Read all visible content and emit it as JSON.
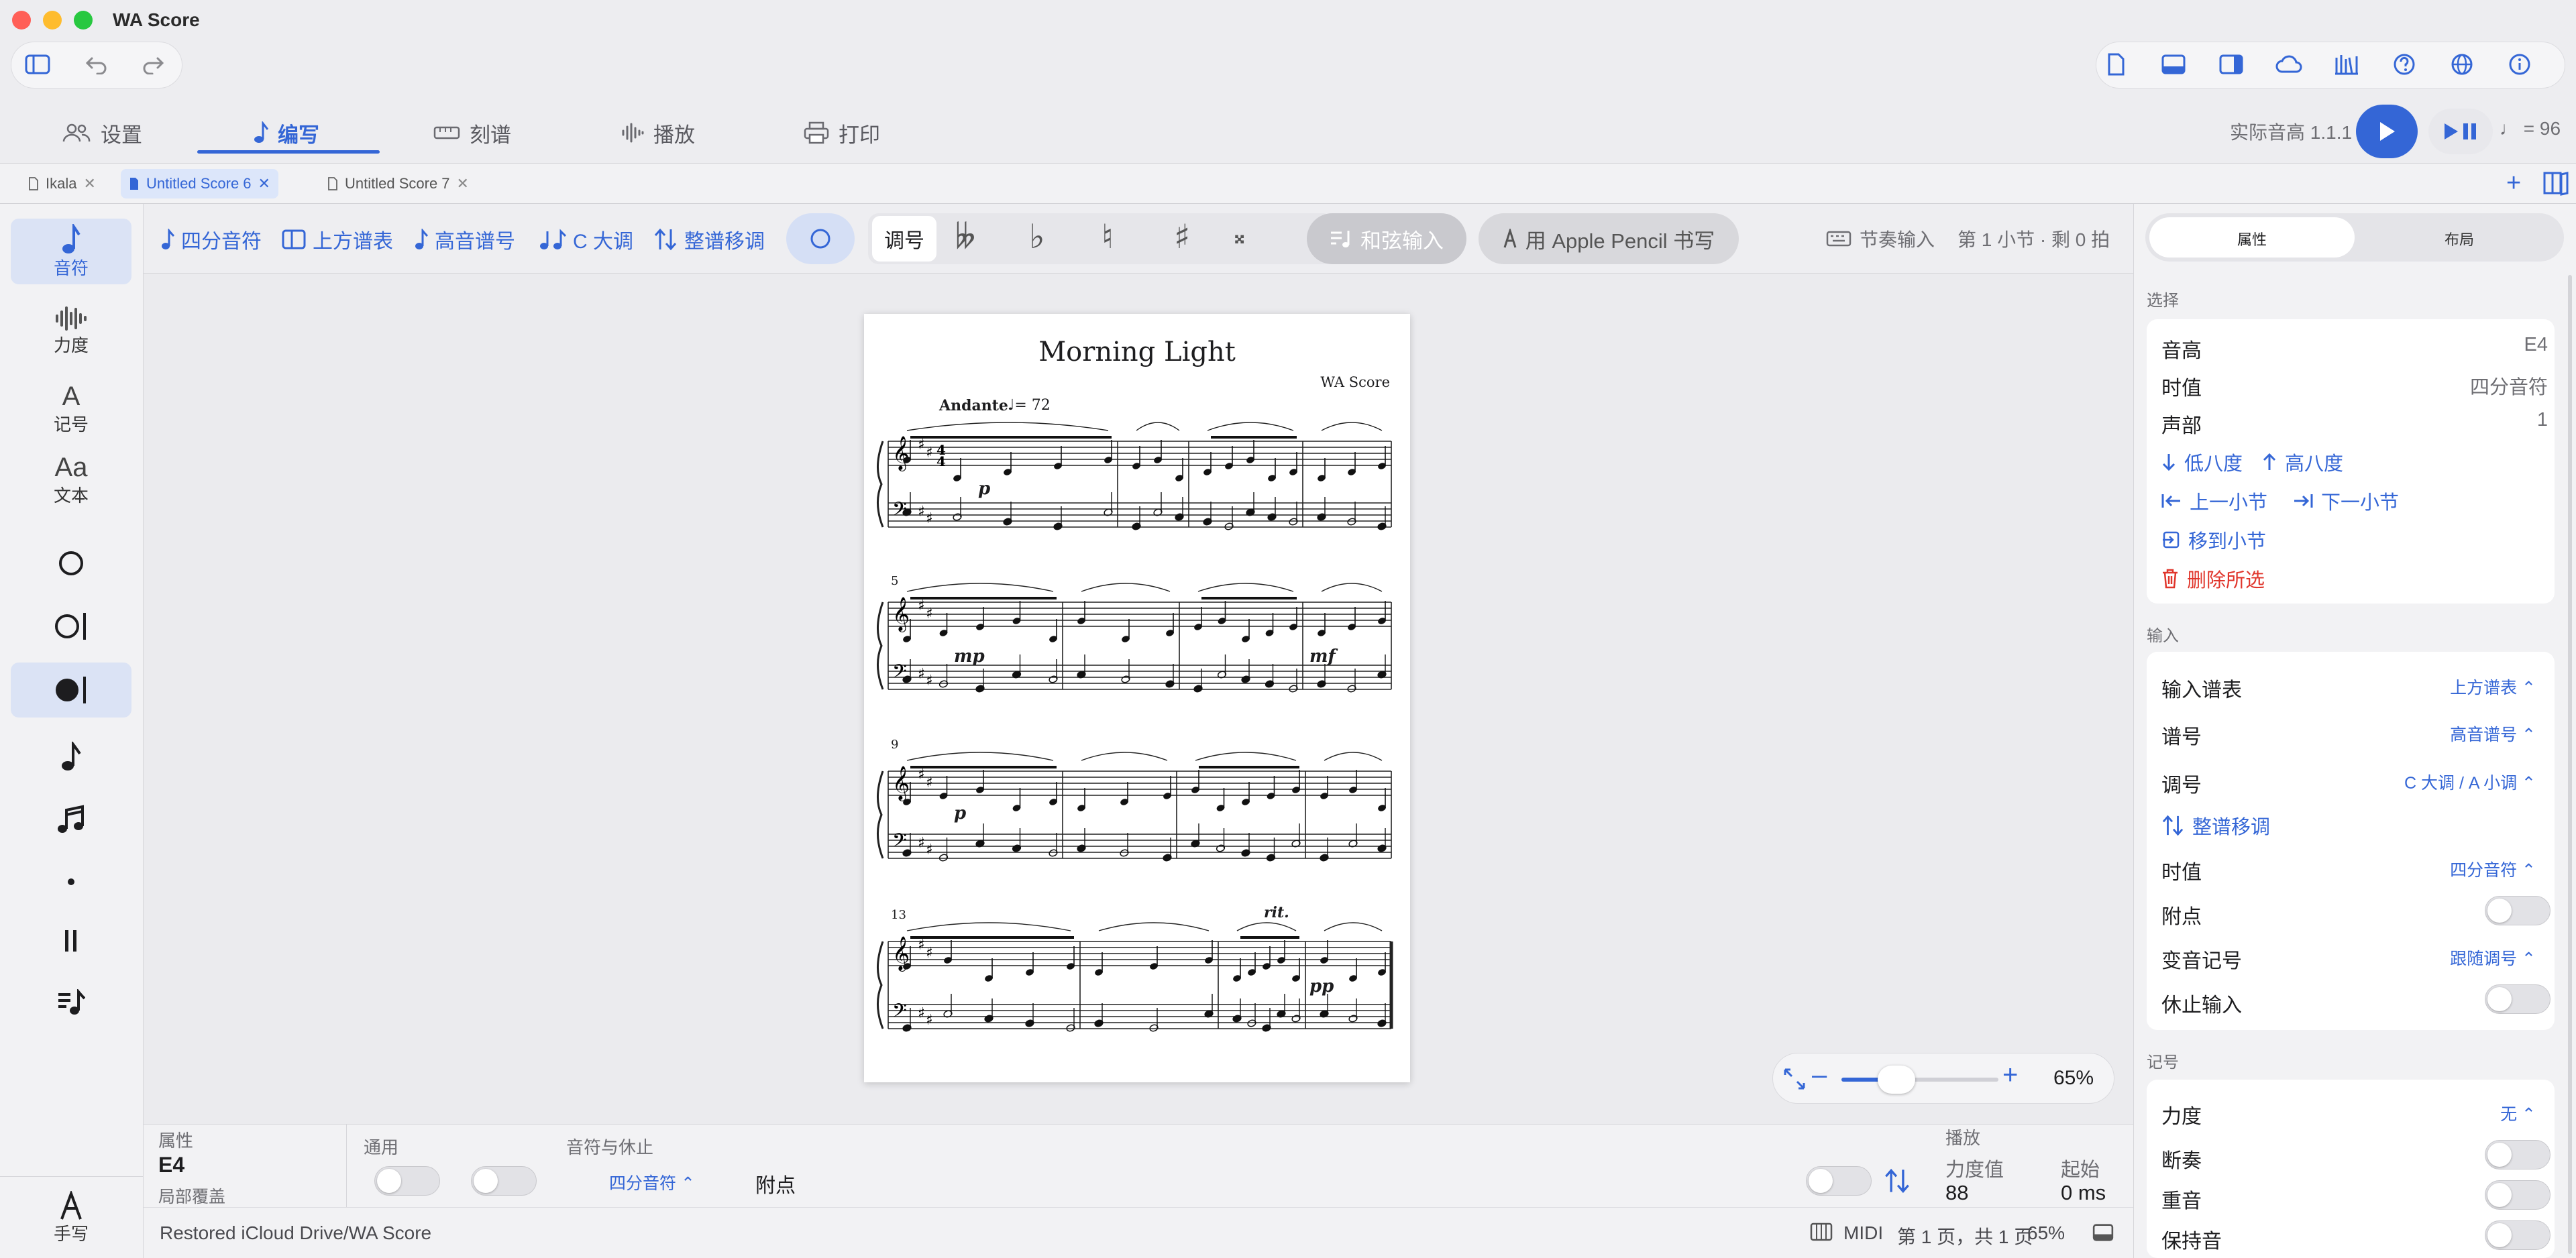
{
  "app": {
    "title": "WA Score"
  },
  "modes": [
    {
      "label": "设置"
    },
    {
      "label": "编写"
    },
    {
      "label": "刻谱"
    },
    {
      "label": "播放"
    },
    {
      "label": "打印"
    }
  ],
  "transport": {
    "pitch_label": "实际音高 1.1.1",
    "tempo": "♩ = 96"
  },
  "doc_tabs": [
    {
      "label": "Ikala"
    },
    {
      "label": "Untitled Score 6"
    },
    {
      "label": "Untitled Score 7"
    }
  ],
  "left_tools": [
    {
      "label": "音符"
    },
    {
      "label": "力度"
    },
    {
      "label": "记号"
    },
    {
      "label": "文本"
    },
    {
      "label": "手写"
    }
  ],
  "left_icon_labels": {
    "text": "Aa",
    "marks": "A"
  },
  "input_bar": {
    "duration": "四分音符",
    "staff": "上方谱表",
    "clef": "高音谱号",
    "key": "C 大调",
    "transpose": "整谱移调",
    "key_tab": "调号",
    "chord_input": "和弦输入",
    "pencil": "用 Apple Pencil 书写",
    "rhythm_input": "节奏输入",
    "position": "第 1 小节 · 剩 0 拍"
  },
  "score": {
    "title": "Morning Light",
    "composer": "WA Score",
    "tempo_mark": "Andante",
    "tempo_value": "♩= 72",
    "measure_numbers": [
      "5",
      "9",
      "13"
    ],
    "dynamics": [
      "p",
      "mp",
      "mf",
      "p",
      "pp"
    ],
    "rit": "rit."
  },
  "zoom": {
    "value": "65%",
    "fraction": 0.35
  },
  "bottom": {
    "section_props": "属性",
    "pitch": "E4",
    "override": "局部覆盖",
    "general": "通用",
    "notes_rests": "音符与休止",
    "duration_value": "四分音符",
    "dot_label": "附点",
    "playback": "播放",
    "velocity_label": "力度值",
    "velocity_value": "88",
    "start_label": "起始",
    "start_value": "0 ms"
  },
  "status": {
    "path": "Restored iCloud Drive/WA Score",
    "midi": "MIDI",
    "page_info": "第 1 页，共 1 页",
    "zoom": "65%"
  },
  "inspector": {
    "tabs": [
      "属性",
      "布局"
    ],
    "selection_title": "选择",
    "selection": [
      {
        "label": "音高",
        "value": "E4"
      },
      {
        "label": "时值",
        "value": "四分音符"
      },
      {
        "label": "声部",
        "value": "1"
      }
    ],
    "octave_down": "低八度",
    "octave_up": "高八度",
    "prev_measure": "上一小节",
    "next_measure": "下一小节",
    "goto_measure": "移到小节",
    "delete": "删除所选",
    "input_title": "输入",
    "input_staff": {
      "label": "输入谱表",
      "value": "上方谱表"
    },
    "clef": {
      "label": "谱号",
      "value": "高音谱号"
    },
    "key": {
      "label": "调号",
      "value": "C 大调 / A 小调"
    },
    "transpose": "整谱移调",
    "duration": {
      "label": "时值",
      "value": "四分音符"
    },
    "dot": {
      "label": "附点"
    },
    "accidental": {
      "label": "变音记号",
      "value": "跟随调号"
    },
    "rest_input": {
      "label": "休止输入"
    },
    "marks_title": "记号",
    "dynamics": {
      "label": "力度",
      "value": "无"
    },
    "staccato": {
      "label": "断奏"
    },
    "accent": {
      "label": "重音"
    },
    "tenuto": {
      "label": "保持音"
    }
  },
  "colors": {
    "accent": "#3466d6",
    "danger": "#e0352b"
  }
}
